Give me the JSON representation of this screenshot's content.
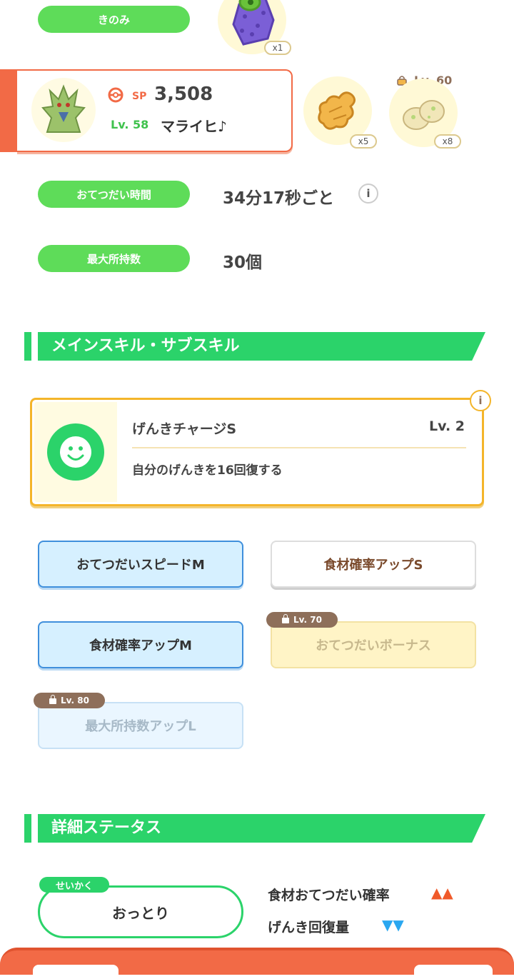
{
  "berry": {
    "label": "きのみ",
    "qty": "x1"
  },
  "pokemon": {
    "sp_label": "SP",
    "sp_value": "3,508",
    "level_label": "Lv. 58",
    "nickname": "マライヒ♪"
  },
  "ingredients": [
    {
      "name": "ginger-icon",
      "qty": "x5"
    },
    {
      "name": "potato-icon",
      "qty": "x8",
      "lock_level": "Lv. 60"
    }
  ],
  "help_time": {
    "label": "おてつだい時間",
    "value": "34分17秒ごと"
  },
  "max_carry": {
    "label": "最大所持数",
    "value": "30個"
  },
  "skills_section": {
    "title": "メインスキル・サブスキル"
  },
  "main_skill": {
    "name": "げんきチャージS",
    "level": "Lv. 2",
    "description": "自分のげんきを16回復する"
  },
  "sub_skills": [
    {
      "label": "おてつだいスピードM",
      "style": "blue"
    },
    {
      "label": "食材確率アップS",
      "style": "white"
    },
    {
      "label": "食材確率アップM",
      "style": "blue"
    },
    {
      "label": "おてつだいボーナス",
      "style": "locked-yellow",
      "lock": "Lv. 70"
    },
    {
      "label": "最大所持数アップL",
      "style": "locked-blue",
      "lock": "Lv. 80"
    }
  ],
  "detail_section": {
    "title": "詳細ステータス"
  },
  "nature": {
    "tag": "せいかく",
    "value": "おっとり",
    "effects": [
      {
        "label": "食材おてつだい確率",
        "arrows": "▲▲",
        "color": "#f05a2a"
      },
      {
        "label": "げんき回復量",
        "arrows": "▼▼",
        "color": "#2aa7f0"
      }
    ]
  },
  "colors": {
    "accent_green": "#2bd36a",
    "pill_green": "#5edc59",
    "bottom_bar": "#f26a46"
  }
}
